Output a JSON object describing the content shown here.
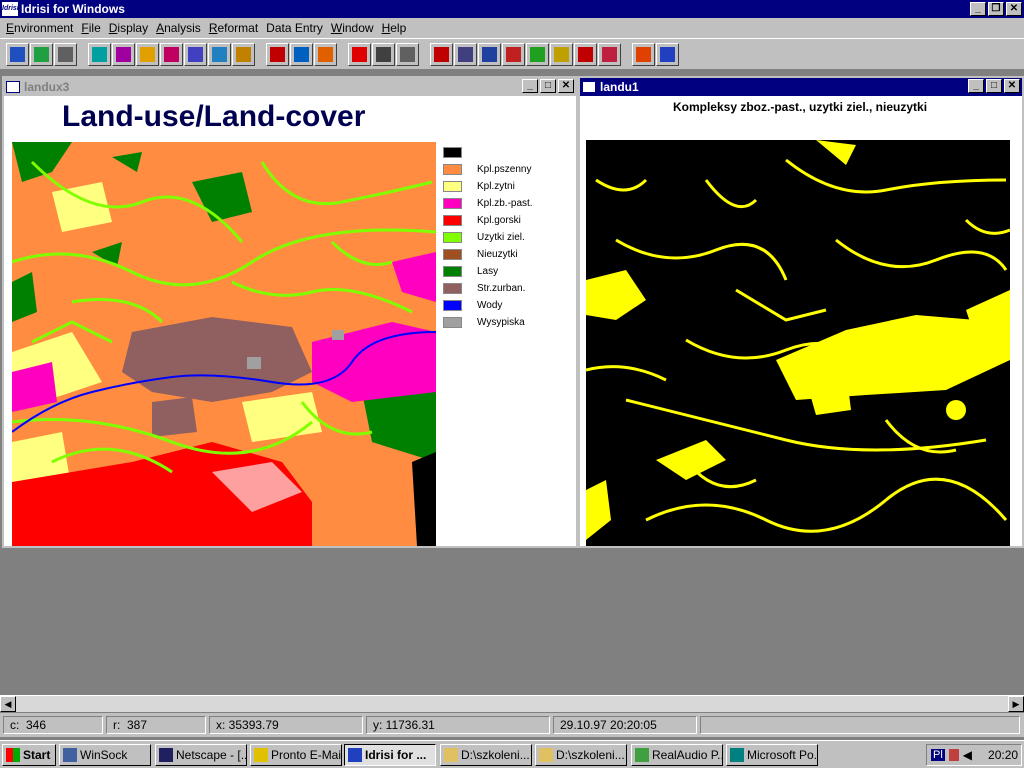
{
  "app": {
    "title": "Idrisi for Windows",
    "icon_text": "Idrisi"
  },
  "menu": [
    {
      "label": "Environment",
      "key": "E",
      "rest": "nvironment"
    },
    {
      "label": "File",
      "key": "F",
      "rest": "ile"
    },
    {
      "label": "Display",
      "key": "D",
      "rest": "isplay"
    },
    {
      "label": "Analysis",
      "key": "A",
      "rest": "nalysis"
    },
    {
      "label": "Reformat",
      "key": "R",
      "rest": "eformat"
    },
    {
      "label": "Data Entry",
      "key": "",
      "rest": "Data Entry"
    },
    {
      "label": "Window",
      "key": "W",
      "rest": "indow"
    },
    {
      "label": "Help",
      "key": "H",
      "rest": "elp"
    }
  ],
  "toolbar_icons": [
    "globe-icon",
    "layers-icon",
    "list-icon",
    "map-icon",
    "digitize-icon",
    "palette-icon",
    "query-icon",
    "window-icon",
    "zoom-icon",
    "updown-icon",
    "histogram-icon",
    "contour-icon",
    "arrows-icon",
    "target-icon",
    "scissors-icon",
    "route-icon",
    "import-icon",
    "table-icon",
    "text-icon",
    "surface-icon",
    "add-layer-icon",
    "export-icon",
    "export2-icon",
    "grid-icon",
    "fire-icon",
    "mountain-icon"
  ],
  "windows": {
    "left": {
      "title": "landux3",
      "map_title": "Land-use/Land-cover",
      "legend": [
        {
          "label": "",
          "color": "#000000"
        },
        {
          "label": "Kpl.pszenny",
          "color": "#ff8c40"
        },
        {
          "label": "Kpl.zytni",
          "color": "#ffff80"
        },
        {
          "label": "Kpl.zb.-past.",
          "color": "#ff00c0"
        },
        {
          "label": "Kpl.gorski",
          "color": "#ff0000"
        },
        {
          "label": "Uzytki ziel.",
          "color": "#80ff00"
        },
        {
          "label": "Nieuzytki",
          "color": "#a05020"
        },
        {
          "label": "Lasy",
          "color": "#008000"
        },
        {
          "label": "Str.zurban.",
          "color": "#906060"
        },
        {
          "label": "Wody",
          "color": "#0000ff"
        },
        {
          "label": "Wysypiska",
          "color": "#a0a0a0"
        }
      ]
    },
    "right": {
      "title": "landu1",
      "map_title": "Kompleksy zboz.-past., uzytki ziel., nieuzytki"
    }
  },
  "status": {
    "c": "c:  346",
    "r": "r:  387",
    "x": "x: 35393.79",
    "y": "y: 11736.31",
    "datetime": "29.10.97 20:20:05"
  },
  "taskbar": {
    "start": "Start",
    "tasks": [
      {
        "label": "WinSock",
        "pressed": false
      },
      {
        "label": "Netscape - [...",
        "pressed": false
      },
      {
        "label": "Pronto E-Mail",
        "pressed": false
      },
      {
        "label": "Idrisi for ...",
        "pressed": true
      },
      {
        "label": "D:\\szkoleni...",
        "pressed": false
      },
      {
        "label": "D:\\szkoleni...",
        "pressed": false
      },
      {
        "label": "RealAudio P...",
        "pressed": false
      },
      {
        "label": "Microsoft Po...",
        "pressed": false
      }
    ],
    "tray_lang": "Pl",
    "clock": "20:20"
  },
  "colors": {
    "titlebar": "#000080",
    "face": "#c0c0c0",
    "desktop": "#808080",
    "map_orange": "#ff8c40",
    "map_yellow": "#ffff00"
  }
}
